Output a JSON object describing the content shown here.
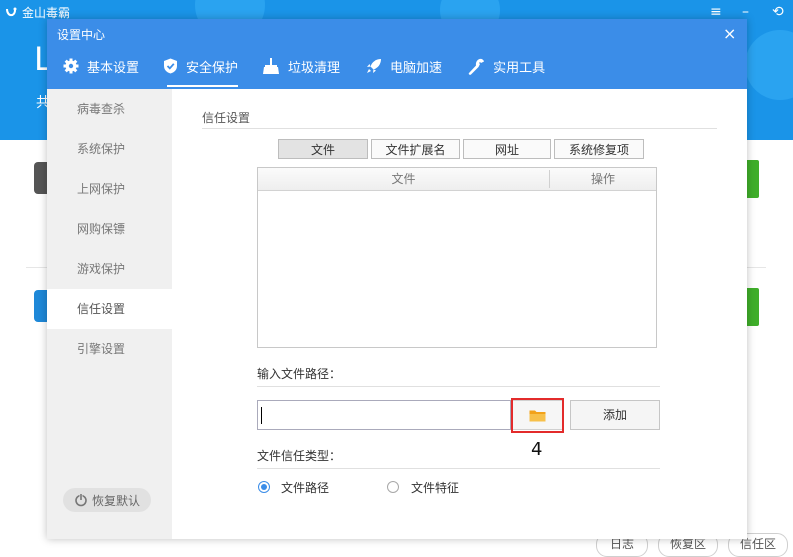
{
  "background": {
    "brand": "金山毒霸",
    "headline_char": "L",
    "sub_char": "共",
    "bottom_buttons": [
      "日志",
      "恢复区",
      "信任区"
    ]
  },
  "dialog": {
    "title": "设置中心",
    "close_glyph": "×",
    "tabs": [
      {
        "label": "基本设置",
        "icon": "gear-icon"
      },
      {
        "label": "安全保护",
        "icon": "shield-icon"
      },
      {
        "label": "垃圾清理",
        "icon": "broom-icon"
      },
      {
        "label": "电脑加速",
        "icon": "rocket-icon"
      },
      {
        "label": "实用工具",
        "icon": "wrench-icon"
      }
    ],
    "active_tab": "安全保护",
    "sidebar": {
      "items": [
        "病毒查杀",
        "系统保护",
        "上网保护",
        "网购保镖",
        "游戏保护",
        "信任设置",
        "引擎设置"
      ],
      "active": "信任设置",
      "restore_label": "恢复默认"
    },
    "content": {
      "section_title": "信任设置",
      "segments": [
        "文件",
        "文件扩展名",
        "网址",
        "系统修复项"
      ],
      "active_segment": "文件",
      "table_headers": [
        "文件",
        "操作"
      ],
      "path_label": "输入文件路径：",
      "path_value": "",
      "add_label": "添加",
      "trust_type_label": "文件信任类型：",
      "radio_options": [
        "文件路径",
        "文件特征"
      ],
      "selected_radio": "文件路径"
    },
    "annotation_number": "4"
  },
  "colors": {
    "accent": "#3b8de8",
    "highlight": "#e32b2b",
    "folder": "#f2a21a"
  }
}
